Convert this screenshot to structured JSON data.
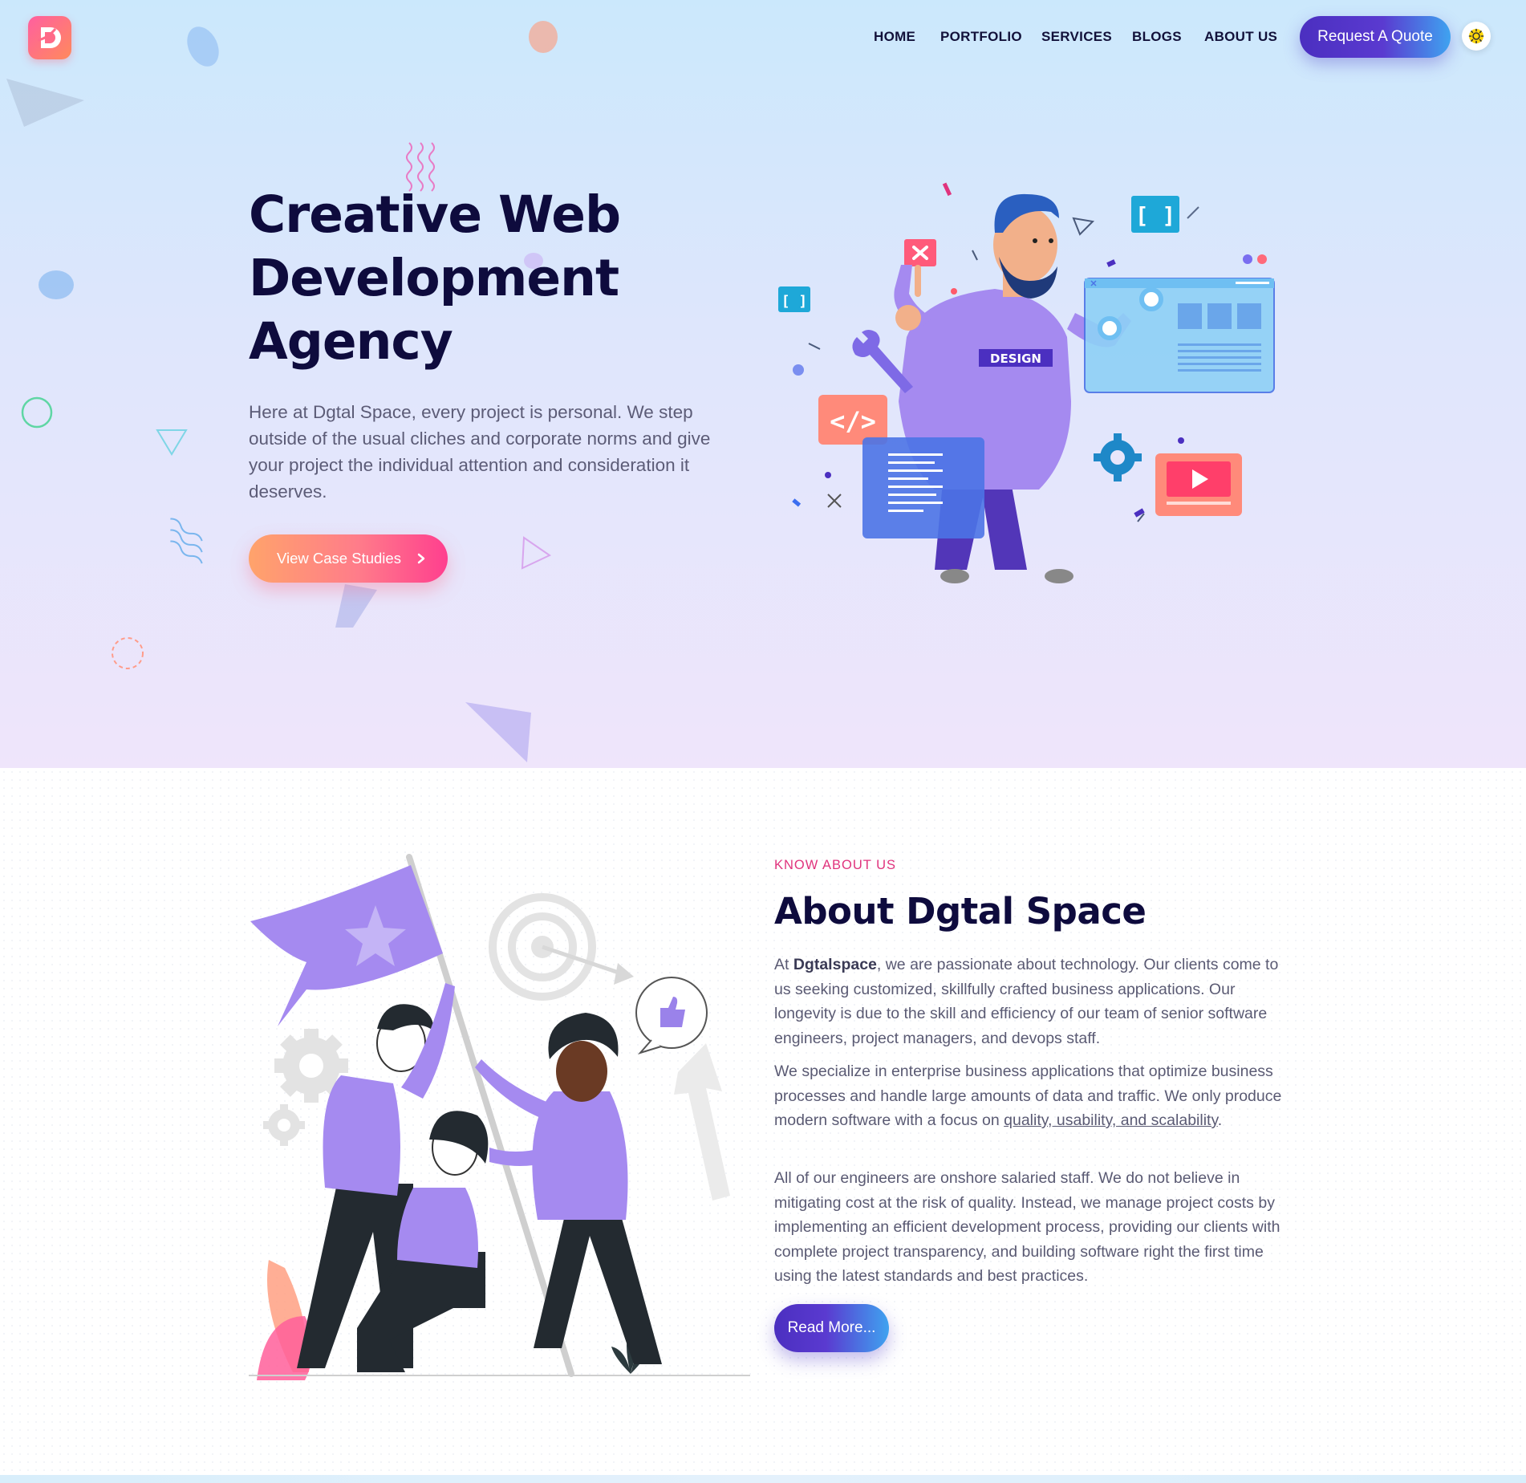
{
  "brand": {
    "logo_icon": "dgtal-logo-icon",
    "accent": "#ff5fa0"
  },
  "nav": {
    "items": [
      {
        "label": "HOME"
      },
      {
        "label": "PORTFOLIO"
      },
      {
        "label": "SERVICES"
      },
      {
        "label": "BLOGS"
      },
      {
        "label": "ABOUT US"
      }
    ],
    "cta_label": "Request A Quote",
    "theme_toggle_icon": "sun-icon"
  },
  "hero": {
    "title_lines": [
      "Creative Web",
      "Development",
      "Agency"
    ],
    "description": "Here at Dgtal Space, every project is personal. We step outside of the usual cliches and corporate norms and give your project the individual attention and consideration it deserves.",
    "cta_label": "View Case Studies",
    "illustration": {
      "shirt_text": "DESIGN",
      "code_tag": "</>",
      "bracket_text": "[ ]"
    }
  },
  "about": {
    "eyebrow": "KNOW ABOUT US",
    "title": "About Dgtal Space",
    "p1_prefix": "At ",
    "p1_bold": "Dgtalspace",
    "p1_rest": ", we are passionate about technology. Our clients come to us seeking customized, skillfully crafted business applications. Our longevity is due to the skill and efficiency of our team of senior software engineers, project managers, and devops staff.",
    "p2_text": "We specialize in enterprise business applications that optimize business processes and handle large amounts of data and traffic. We only produce modern software with a focus on ",
    "p2_link": "quality, usability, and scalability",
    "p2_end": ".",
    "p3": "All of our engineers are onshore salaried staff. We do not believe in mitigating cost at the risk of quality. Instead, we manage project costs by implementing an efficient development process, providing our clients with complete project transparency, and building software right the first time using the latest standards and best practices.",
    "cta_label": "Read More..."
  }
}
